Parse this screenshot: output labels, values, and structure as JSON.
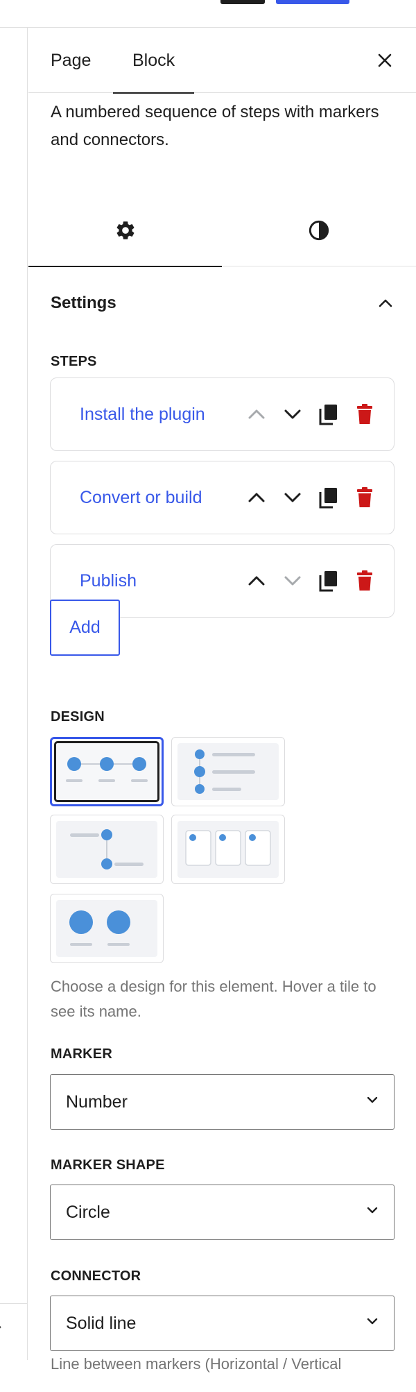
{
  "sidebar_tabs": {
    "page": "Page",
    "block": "Block"
  },
  "block_description": "A numbered sequence of steps with markers and connectors.",
  "settings_panel": {
    "title": "Settings"
  },
  "steps": {
    "label": "STEPS",
    "items": [
      {
        "label": "Install the plugin"
      },
      {
        "label": "Convert or build"
      },
      {
        "label": "Publish"
      }
    ],
    "add_label": "Add"
  },
  "design": {
    "label": "DESIGN",
    "help": "Choose a design for this element. Hover a tile to see its name."
  },
  "marker": {
    "label": "MARKER",
    "value": "Number"
  },
  "marker_shape": {
    "label": "MARKER SHAPE",
    "value": "Circle"
  },
  "connector": {
    "label": "CONNECTOR",
    "value": "Solid line"
  },
  "connector_help_clipped": "Line between markers (Horizontal / Vertical",
  "colors": {
    "accent": "#3858e9",
    "danger": "#cc1818",
    "text": "#1e1e1e",
    "muted": "#757575",
    "tile_dot": "#4a90d9"
  }
}
